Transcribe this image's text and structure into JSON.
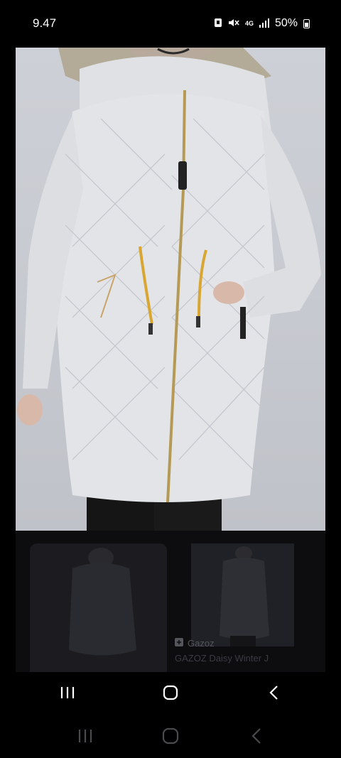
{
  "status_bar": {
    "time": "9.47",
    "network": "4G",
    "battery": "50%"
  },
  "product": {
    "brand": "Gazoz",
    "title": "GAZOZ Daisy Winter J",
    "zipper_tag": "Gazoz"
  },
  "icons": {
    "recents": "recents-icon",
    "home": "home-icon",
    "back": "back-icon",
    "brand_logo": "gazoz-logo-icon"
  }
}
